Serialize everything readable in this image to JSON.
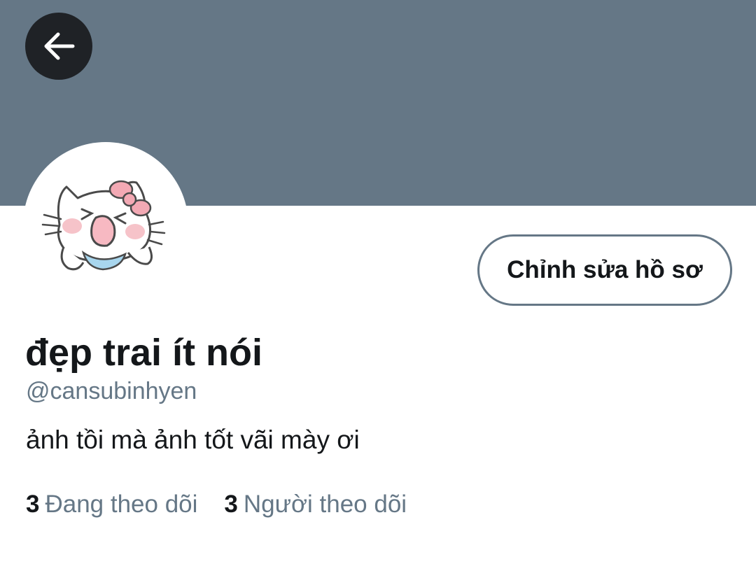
{
  "header": {
    "banner_color": "#657786",
    "back_icon": "arrow-left-icon"
  },
  "profile": {
    "avatar_icon": "hello-kitty-avatar",
    "edit_button_label": "Chỉnh sửa hồ sơ",
    "display_name": "đẹp trai ít nói",
    "handle": "@cansubinhyen",
    "bio": "ảnh tồi mà ảnh tốt vãi mày ơi"
  },
  "stats": {
    "following_count": "3",
    "following_label": "Đang theo dõi",
    "followers_count": "3",
    "followers_label": "Người theo dõi"
  },
  "colors": {
    "text_primary": "#14171a",
    "text_secondary": "#657786",
    "back_button_bg": "#1f2226"
  }
}
